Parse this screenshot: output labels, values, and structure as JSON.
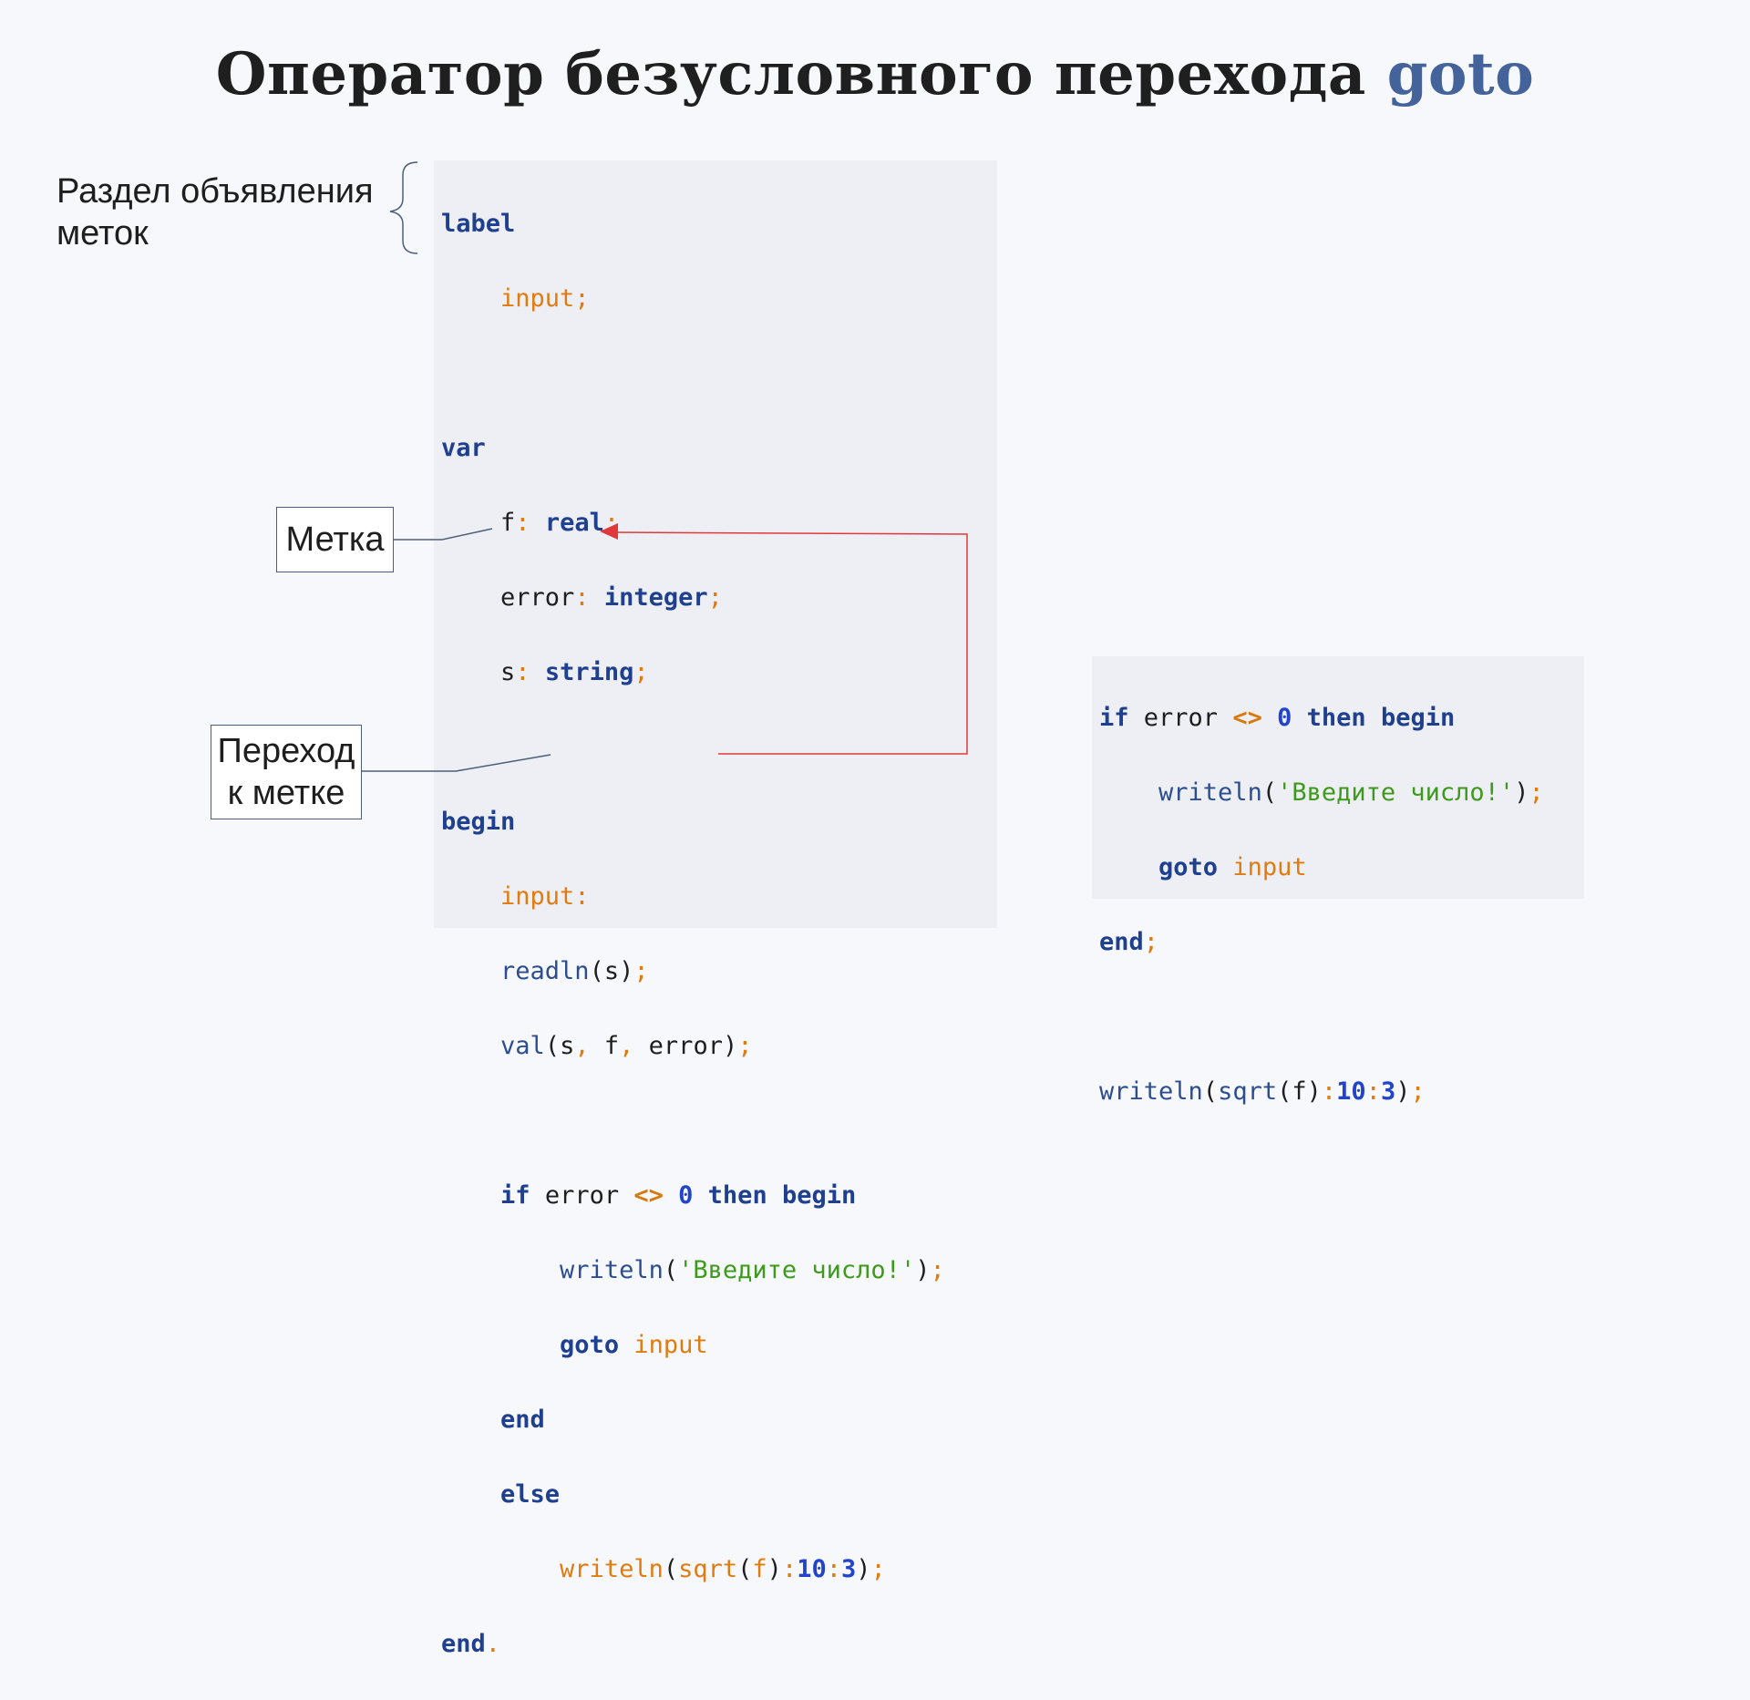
{
  "slide": {
    "title_main": "Оператор безусловного перехода",
    "title_accent": "goto",
    "accent_color": "#45639b"
  },
  "annotations": {
    "label_section_line1": "Раздел объявления",
    "label_section_line2": "меток",
    "label_mark": "Метка",
    "jump_line1": "Переход",
    "jump_line2": "к метке"
  },
  "code_main": {
    "kw_label": "label",
    "label_decl": "input",
    "kw_var": "var",
    "var_f": "f",
    "type_real": "real",
    "var_error": "error",
    "type_integer": "integer",
    "var_s": "s",
    "type_string": "string",
    "kw_begin": "begin",
    "label_input": "input",
    "fn_readln": "readln",
    "arg_s": "s",
    "fn_val": "val",
    "val_args_s": "s",
    "val_args_f": "f",
    "val_args_error": "error",
    "kw_if": "if",
    "cond_var": "error",
    "cond_op": "<>",
    "cond_num": "0",
    "kw_then": "then",
    "kw_begin2": "begin",
    "fn_writeln": "writeln",
    "str_prompt": "'Введите число!'",
    "kw_goto": "goto",
    "goto_target": "input",
    "kw_end": "end",
    "kw_else": "else",
    "fn_writeln2": "writeln",
    "fn_sqrt": "sqrt",
    "sqrt_arg": "f",
    "fmt_width": "10",
    "fmt_prec": "3",
    "kw_end_final": "end"
  },
  "code_alt": {
    "kw_if": "if",
    "cond_var": "error",
    "cond_op": "<>",
    "cond_num": "0",
    "kw_then": "then",
    "kw_begin": "begin",
    "fn_writeln": "writeln",
    "str_prompt": "'Введите число!'",
    "kw_goto": "goto",
    "goto_target": "input",
    "kw_end": "end",
    "fn_writeln2": "writeln",
    "fn_sqrt": "sqrt",
    "sqrt_arg": "f",
    "fmt_width": "10",
    "fmt_prec": "3"
  }
}
